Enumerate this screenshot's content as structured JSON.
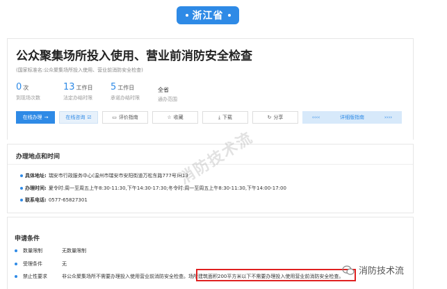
{
  "region": {
    "label": "浙江省"
  },
  "service": {
    "title": "公众聚集场所投入使用、营业前消防安全检查",
    "subtitle": "(国家标准名:公众聚集场所投入使用、营业前消防安全检查)",
    "stats": [
      {
        "num": "0",
        "unit": "次",
        "label": "到现场次数"
      },
      {
        "num": "13",
        "unit": "工作日",
        "label": "法定办结时限"
      },
      {
        "num": "5",
        "unit": "工作日",
        "label": "承诺办结时限"
      },
      {
        "value": "全省",
        "label": "通办范围"
      }
    ],
    "buttons": {
      "online": "在线办理",
      "consult": "在线咨询",
      "evaluate": "评价指南",
      "favorite": "收藏",
      "download": "下载",
      "share": "分享",
      "guide": "详细版指南"
    }
  },
  "location": {
    "title": "办理地点和时间",
    "address_key": "具体地址:",
    "address": "瑞安市行政服务中心(温州市瑞安市安阳街道万松东路777号)H13",
    "hours_key": "办理时间:",
    "hours": "夏令时:周一至周五上午8:30-11:30,下午14:30-17:30;冬令时:周一至周五上午8:30-11:30,下午14:00-17:00",
    "phone_key": "联系电话:",
    "phone": "0577-65827301"
  },
  "conditions": {
    "title": "申请条件",
    "rows": [
      {
        "key": "数量限制",
        "value": "无数量限制"
      },
      {
        "key": "受理条件",
        "value": "无"
      },
      {
        "key": "禁止性要求",
        "value": "非公众聚集场所不需要办理投入使用营业前消防安全检查。场所建筑面积200平方米以下不需要办理投入使用营业前消防安全检查。"
      }
    ]
  },
  "watermark": {
    "text": "消防技术流"
  },
  "footer_badge": {
    "text": "消防技术流"
  },
  "colors": {
    "accent": "#2e8ae6",
    "highlight": "#e02020"
  }
}
